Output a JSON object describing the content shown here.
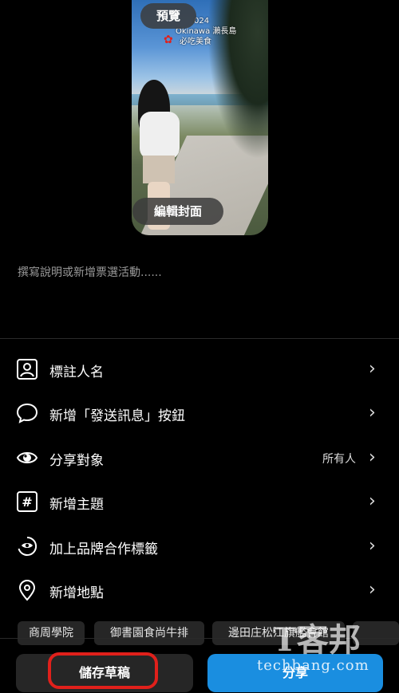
{
  "cover": {
    "preview_label": "預覽",
    "edit_cover_label": "編輯封面",
    "overlay_line1": "024",
    "overlay_line2": "Okinawa 瀨長島",
    "overlay_line3": "必吃美食"
  },
  "caption": {
    "placeholder": "撰寫說明或新增票選活動......"
  },
  "options": [
    {
      "label": "標註人名",
      "icon": "tag-person-icon"
    },
    {
      "label": "新增「發送訊息」按鈕",
      "icon": "chat-bubble-icon"
    },
    {
      "label": "分享對象",
      "value": "所有人",
      "icon": "eye-icon"
    },
    {
      "label": "新增主題",
      "icon": "hashtag-icon"
    },
    {
      "label": "加上品牌合作標籤",
      "icon": "brand-partnership-icon"
    },
    {
      "label": "新增地點",
      "icon": "location-pin-icon"
    }
  ],
  "location_suggestions": [
    "商周學院",
    "御書園食尚牛排",
    "邊田庄松江旗艦會館"
  ],
  "actions": {
    "save_draft": "儲存草稿",
    "share": "分享"
  },
  "watermark": {
    "brand": "T客邦",
    "url": "techbang.com"
  },
  "colors": {
    "share_button": "#1a8ee0",
    "highlight": "#e0201b",
    "background": "#000000"
  }
}
